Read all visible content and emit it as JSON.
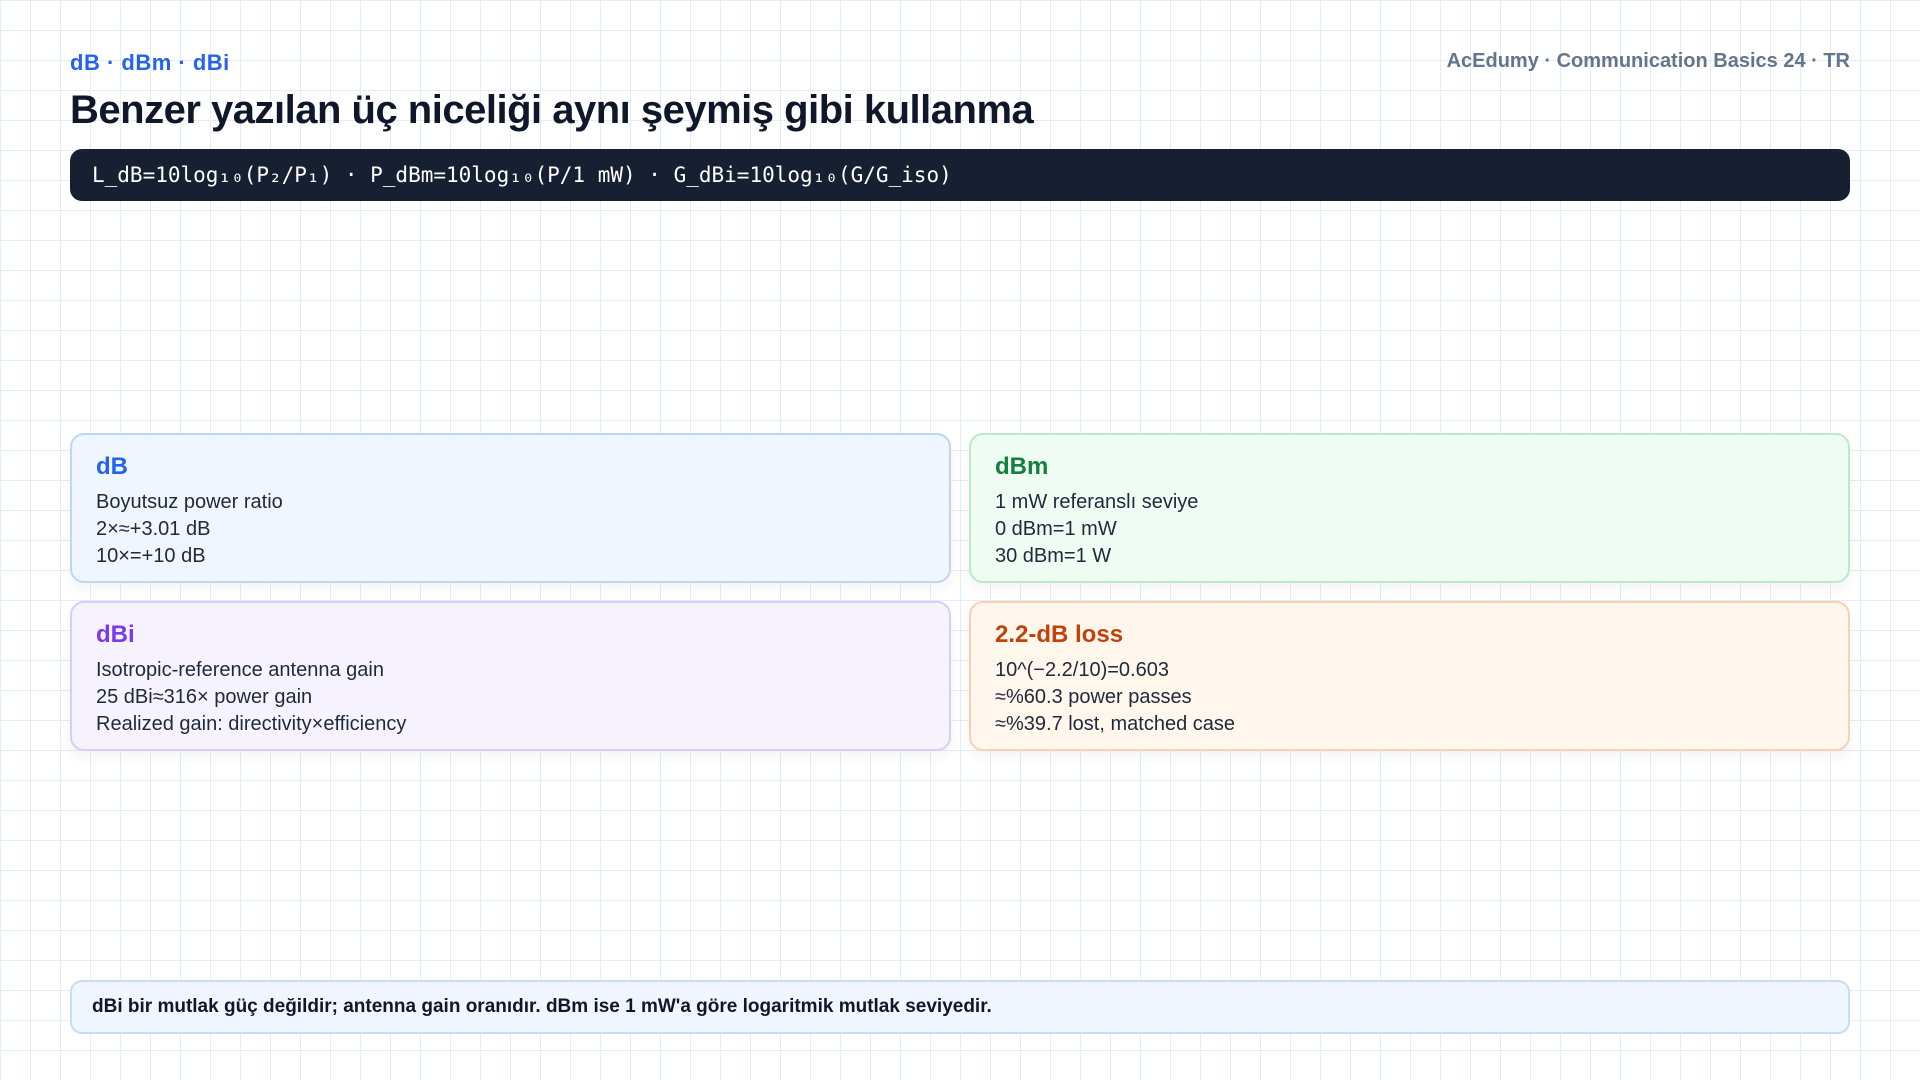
{
  "header": {
    "kicker": "dB · dBm · dBi",
    "brand": "AcEdumy · Communication Basics 24 · TR",
    "title": "Benzer yazılan üç niceliği aynı şeymiş gibi kullanma"
  },
  "formula": "L_dB=10log₁₀(P₂/P₁) · P_dBm=10log₁₀(P/1 mW) · G_dBi=10log₁₀(G/G_iso)",
  "cards": [
    {
      "title": "dB",
      "accent": "#2563eb",
      "bg": "#eff6ff",
      "border": "#bfd6f2",
      "lines": [
        "Boyutsuz power ratio",
        "2×≈+3.01 dB",
        "10×=+10 dB"
      ]
    },
    {
      "title": "dBm",
      "accent": "#15803d",
      "bg": "#effcf3",
      "border": "#bde8cb",
      "lines": [
        "1 mW referanslı seviye",
        "0 dBm=1 mW",
        "30 dBm=1 W"
      ]
    },
    {
      "title": "dBi",
      "accent": "#7c3aed",
      "bg": "#f6f3ff",
      "border": "#d9cdf7",
      "lines": [
        "Isotropic-reference antenna gain",
        "25 dBi≈316× power gain",
        "Realized gain: directivity×efficiency"
      ]
    },
    {
      "title": "2.2-dB loss",
      "accent": "#c2410c",
      "bg": "#fff6ec",
      "border": "#f8d2b0",
      "lines": [
        "10^(−2.2/10)=0.603",
        "≈%60.3 power passes",
        "≈%39.7 lost, matched case"
      ]
    }
  ],
  "note": "dBi bir mutlak güç değildir; antenna gain oranıdır. dBm ise 1 mW'a göre logaritmik mutlak seviyedir."
}
